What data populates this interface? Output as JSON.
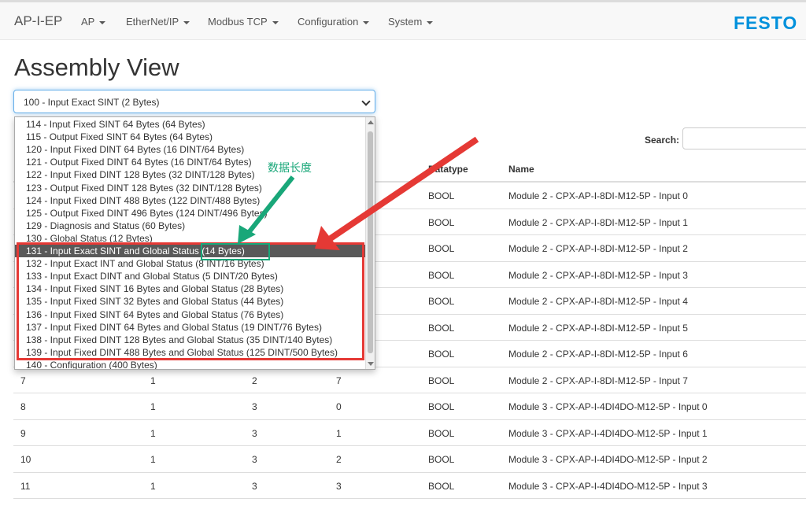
{
  "navbar": {
    "brand": "AP-I-EP",
    "items": [
      {
        "label": "AP"
      },
      {
        "label": "EtherNet/IP"
      },
      {
        "label": "Modbus TCP"
      },
      {
        "label": "Configuration"
      },
      {
        "label": "System"
      }
    ],
    "logo": "FESTO"
  },
  "page": {
    "title": "Assembly View"
  },
  "assembly_select": {
    "selected": "100 - Input Exact SINT (2 Bytes)",
    "options": [
      "114 - Input Fixed SINT 64 Bytes (64 Bytes)",
      "115 - Output Fixed SINT 64 Bytes (64 Bytes)",
      "120 - Input Fixed DINT 64 Bytes (16 DINT/64 Bytes)",
      "121 - Output Fixed DINT 64 Bytes (16 DINT/64 Bytes)",
      "122 - Input Fixed DINT 128 Bytes (32 DINT/128 Bytes)",
      "123 - Output Fixed DINT 128 Bytes (32 DINT/128 Bytes)",
      "124 - Input Fixed DINT 488 Bytes (122 DINT/488 Bytes)",
      "125 - Output Fixed DINT 496 Bytes (124 DINT/496 Bytes)",
      "129 - Diagnosis and Status (60 Bytes)",
      "130 - Global Status (12 Bytes)",
      "131 - Input Exact SINT and Global Status (14 Bytes)",
      "132 - Input Exact INT and Global Status (8 INT/16 Bytes)",
      "133 - Input Exact DINT and Global Status (5 DINT/20 Bytes)",
      "134 - Input Fixed SINT 16 Bytes and Global Status (28 Bytes)",
      "135 - Input Fixed SINT 32 Bytes and Global Status (44 Bytes)",
      "136 - Input Fixed SINT 64 Bytes and Global Status (76 Bytes)",
      "137 - Input Fixed DINT 64 Bytes and Global Status (19 DINT/76 Bytes)",
      "138 - Input Fixed DINT 128 Bytes and Global Status (35 DINT/140 Bytes)",
      "139 - Input Fixed DINT 488 Bytes and Global Status (125 DINT/500 Bytes)",
      "140 - Configuration (400 Bytes)"
    ],
    "highlighted_option": "131 - Input Exact SINT and Global Status (14 Bytes)"
  },
  "search": {
    "label": "Search:",
    "value": ""
  },
  "table": {
    "visible_headers": [
      "",
      "",
      "",
      "",
      "Datatype",
      "Name"
    ],
    "rows": [
      [
        "",
        "",
        "",
        "",
        "BOOL",
        "Module 2 - CPX-AP-I-8DI-M12-5P - Input 0"
      ],
      [
        "",
        "",
        "",
        "",
        "BOOL",
        "Module 2 - CPX-AP-I-8DI-M12-5P - Input 1"
      ],
      [
        "",
        "",
        "",
        "",
        "BOOL",
        "Module 2 - CPX-AP-I-8DI-M12-5P - Input 2"
      ],
      [
        "",
        "",
        "",
        "",
        "BOOL",
        "Module 2 - CPX-AP-I-8DI-M12-5P - Input 3"
      ],
      [
        "",
        "",
        "",
        "",
        "BOOL",
        "Module 2 - CPX-AP-I-8DI-M12-5P - Input 4"
      ],
      [
        "",
        "",
        "",
        "",
        "BOOL",
        "Module 2 - CPX-AP-I-8DI-M12-5P - Input 5"
      ],
      [
        "",
        "",
        "",
        "",
        "BOOL",
        "Module 2 - CPX-AP-I-8DI-M12-5P - Input 6"
      ],
      [
        "7",
        "1",
        "2",
        "7",
        "BOOL",
        "Module 2 - CPX-AP-I-8DI-M12-5P - Input 7"
      ],
      [
        "8",
        "1",
        "3",
        "0",
        "BOOL",
        "Module 3 - CPX-AP-I-4DI4DO-M12-5P - Input 0"
      ],
      [
        "9",
        "1",
        "3",
        "1",
        "BOOL",
        "Module 3 - CPX-AP-I-4DI4DO-M12-5P - Input 1"
      ],
      [
        "10",
        "1",
        "3",
        "2",
        "BOOL",
        "Module 3 - CPX-AP-I-4DI4DO-M12-5P - Input 2"
      ],
      [
        "11",
        "1",
        "3",
        "3",
        "BOOL",
        "Module 3 - CPX-AP-I-4DI4DO-M12-5P - Input 3"
      ]
    ]
  },
  "annotation": {
    "text": "数据长度",
    "colors": {
      "green": "#19a779",
      "red": "#e53935"
    }
  },
  "colors": {
    "brand_blue": "#0091dc",
    "highlight_bg": "#595959"
  }
}
